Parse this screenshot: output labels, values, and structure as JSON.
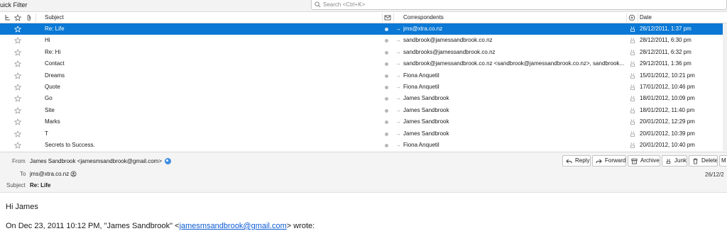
{
  "toolbar": {
    "quick_filter_label": "uick Filter",
    "search_placeholder": "Search <Ctrl+K>"
  },
  "columns": {
    "subject": "Subject",
    "correspondents": "Correspondents",
    "date": "Date"
  },
  "messages": [
    {
      "subject": "Re: Life",
      "correspondent": "jms@xtra.co.nz",
      "date": "26/12/2011, 1:37 pm",
      "selected": true
    },
    {
      "subject": "Hi",
      "correspondent": "sandbrook@jamessandbrook.co.nz",
      "date": "28/12/2011, 6:30 pm"
    },
    {
      "subject": "Re: Hi",
      "correspondent": "sandbrooks@jamessandbrook.co.nz",
      "date": "28/12/2011, 6:32 pm"
    },
    {
      "subject": "Contact",
      "correspondent": "sandbrook@jamessandbrook.co.nz <sandbrook@jamessandbrook.co.nz>, sandbrook...",
      "date": "29/12/2011, 1:36 pm"
    },
    {
      "subject": "Dreams",
      "correspondent": "Fiona Anquetil",
      "date": "15/01/2012, 10:21 pm"
    },
    {
      "subject": "Quote",
      "correspondent": "Fiona Anquetil",
      "date": "17/01/2012, 10:46 pm"
    },
    {
      "subject": "Go",
      "correspondent": "James Sandbrook",
      "date": "18/01/2012, 10:09 pm"
    },
    {
      "subject": "Site",
      "correspondent": "James Sandbrook",
      "date": "18/01/2012, 11:40 pm"
    },
    {
      "subject": "Marks",
      "correspondent": "James Sandbrook",
      "date": "20/01/2012, 12:29 pm"
    },
    {
      "subject": "T",
      "correspondent": "James Sandbrook",
      "date": "20/01/2012, 10:39 pm"
    },
    {
      "subject": "Secrets to Success.",
      "correspondent": "Fiona Anquetil",
      "date": "20/01/2012, 10:40 pm"
    }
  ],
  "message_header": {
    "from_label": "From",
    "from_value": "James Sandbrook <jamesmsandbrook@gmail.com>",
    "to_label": "To",
    "to_value": "jms@xtra.co.nz",
    "subject_label": "Subject",
    "subject_value": "Re: Life",
    "date_value": "26/12/2"
  },
  "actions": {
    "reply": "Reply",
    "forward": "Forward",
    "archive": "Archive",
    "junk": "Junk",
    "delete": "Delete",
    "more": "M"
  },
  "body": {
    "greeting": "Hi James",
    "quote_prefix": "On Dec 23, 2011 10:12 PM, \"James Sandbrook\" <",
    "quote_link": "jamesmsandbrook@gmail.com",
    "quote_suffix": "> wrote:"
  },
  "colors": {
    "selection": "#0a78d4",
    "link": "#0b5bd3"
  }
}
